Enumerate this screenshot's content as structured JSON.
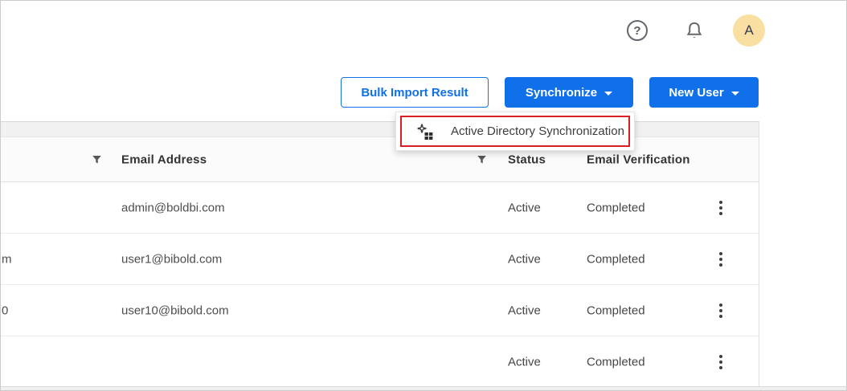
{
  "header": {
    "help_glyph": "?",
    "avatar_letter": "A"
  },
  "toolbar": {
    "bulk_import_label": "Bulk Import Result",
    "synchronize_label": "Synchronize",
    "new_user_label": "New User"
  },
  "dropdown": {
    "item_label": "Active Directory Synchronization"
  },
  "table": {
    "headers": {
      "email": "Email Address",
      "status": "Status",
      "verification": "Email Verification"
    },
    "rows": [
      {
        "left_truncated": "",
        "email": "admin@boldbi.com",
        "status": "Active",
        "verification": "Completed"
      },
      {
        "left_truncated": "m",
        "email": "user1@bibold.com",
        "status": "Active",
        "verification": "Completed"
      },
      {
        "left_truncated": "0",
        "email": "user10@bibold.com",
        "status": "Active",
        "verification": "Completed"
      },
      {
        "left_truncated": "",
        "email": "",
        "status": "Active",
        "verification": "Completed"
      }
    ]
  },
  "colors": {
    "accent_blue": "#0f70ea",
    "annotation_red": "#d91f26",
    "avatar_bg": "#fadfa3"
  }
}
